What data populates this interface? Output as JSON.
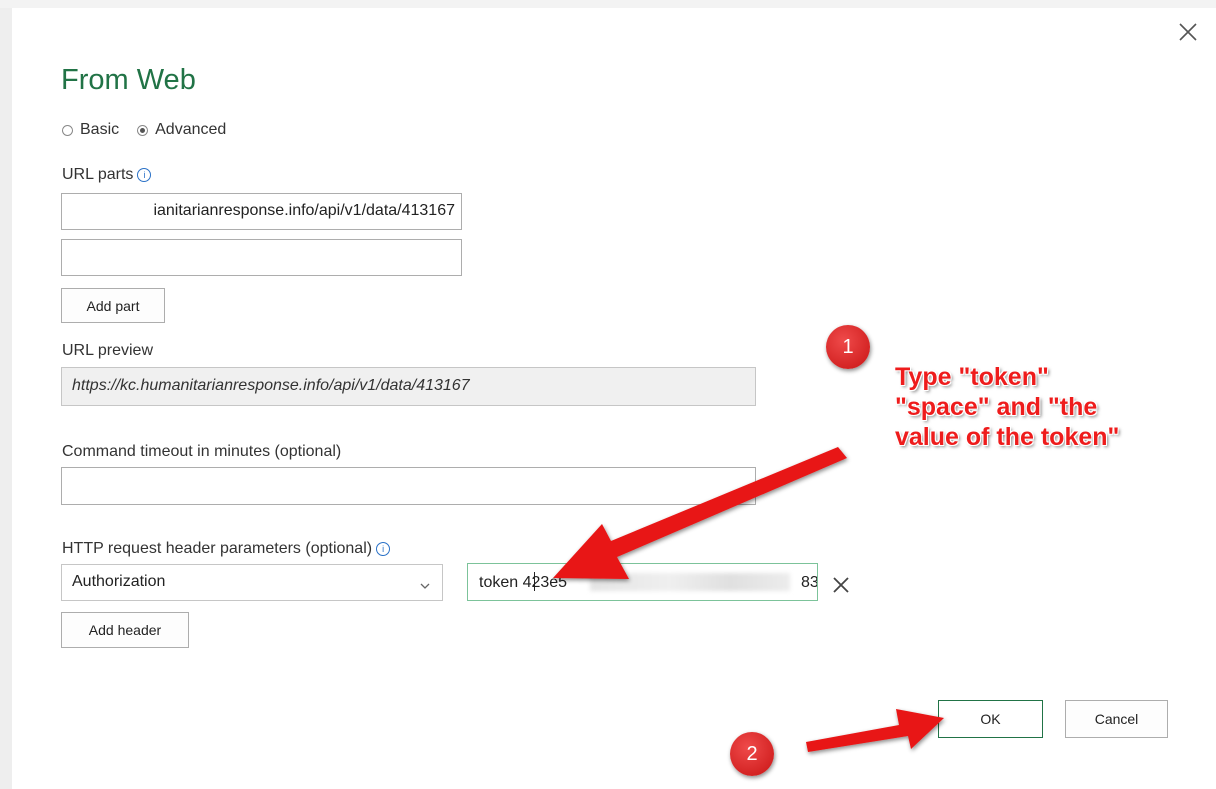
{
  "dialog": {
    "title": "From Web",
    "mode": {
      "options": [
        "Basic",
        "Advanced"
      ],
      "selected": "Advanced"
    },
    "url_parts": {
      "label": "URL parts",
      "parts": [
        "https://kc.humanitarianresponse.info/api/v1/data/413167",
        ""
      ],
      "visible_part_1": "ianitarianresponse.info/api/v1/data/413167",
      "add_part_label": "Add part"
    },
    "url_preview": {
      "label": "URL preview",
      "value": "https://kc.humanitarianresponse.info/api/v1/data/413167"
    },
    "timeout": {
      "label": "Command timeout in minutes (optional)",
      "value": ""
    },
    "http_headers": {
      "label": "HTTP request header parameters (optional)",
      "header_name": "Authorization",
      "header_value_prefix": "token 423e5",
      "header_value_suffix": "83",
      "add_header_label": "Add header"
    },
    "buttons": {
      "ok": "OK",
      "cancel": "Cancel"
    }
  },
  "annotations": {
    "step1_badge": "1",
    "step1_text_line1": "Type \"token\"",
    "step1_text_line2": "\"space\" and \"the",
    "step1_text_line3": "value of the token\"",
    "step2_badge": "2",
    "color": "#ee1c1c"
  },
  "colors": {
    "accent": "#217346",
    "info": "#2a71c7"
  },
  "icons": {
    "close": "close-icon",
    "info": "info-icon",
    "dropdown": "chevron-down-icon",
    "remove": "remove-icon"
  }
}
